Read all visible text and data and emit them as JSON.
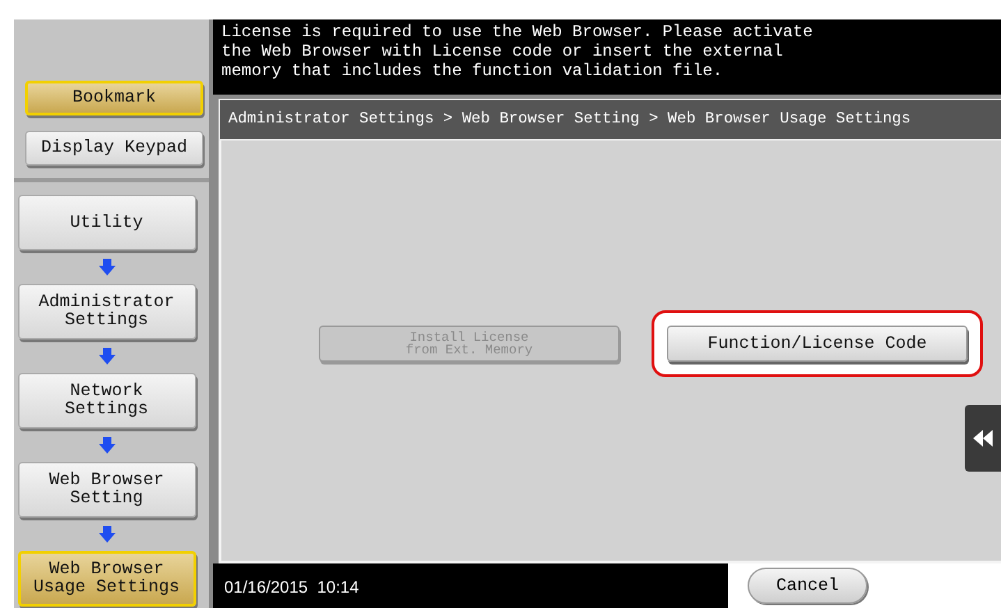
{
  "message": "License is required to use the Web Browser. Please activate\nthe Web Browser with License code or insert the external\nmemory that includes the function validation file.",
  "sidebar": {
    "top_buttons": [
      {
        "label": "Bookmark",
        "selected": true
      },
      {
        "label": "Display Keypad",
        "selected": false
      }
    ],
    "path": [
      {
        "label": "Utility",
        "selected": false
      },
      {
        "label": "Administrator\nSettings",
        "selected": false
      },
      {
        "label": "Network\nSettings",
        "selected": false
      },
      {
        "label": "Web Browser\nSetting",
        "selected": false
      },
      {
        "label": "Web Browser\nUsage Settings",
        "selected": true
      }
    ]
  },
  "breadcrumb": "Administrator Settings > Web Browser Setting > Web Browser Usage Settings",
  "buttons": [
    {
      "label": "Install License\nfrom Ext. Memory",
      "disabled": true,
      "highlighted": false
    },
    {
      "label": "Function/License Code",
      "disabled": false,
      "highlighted": true
    }
  ],
  "datetime": "01/16/2015  10:14",
  "cancel": "Cancel"
}
